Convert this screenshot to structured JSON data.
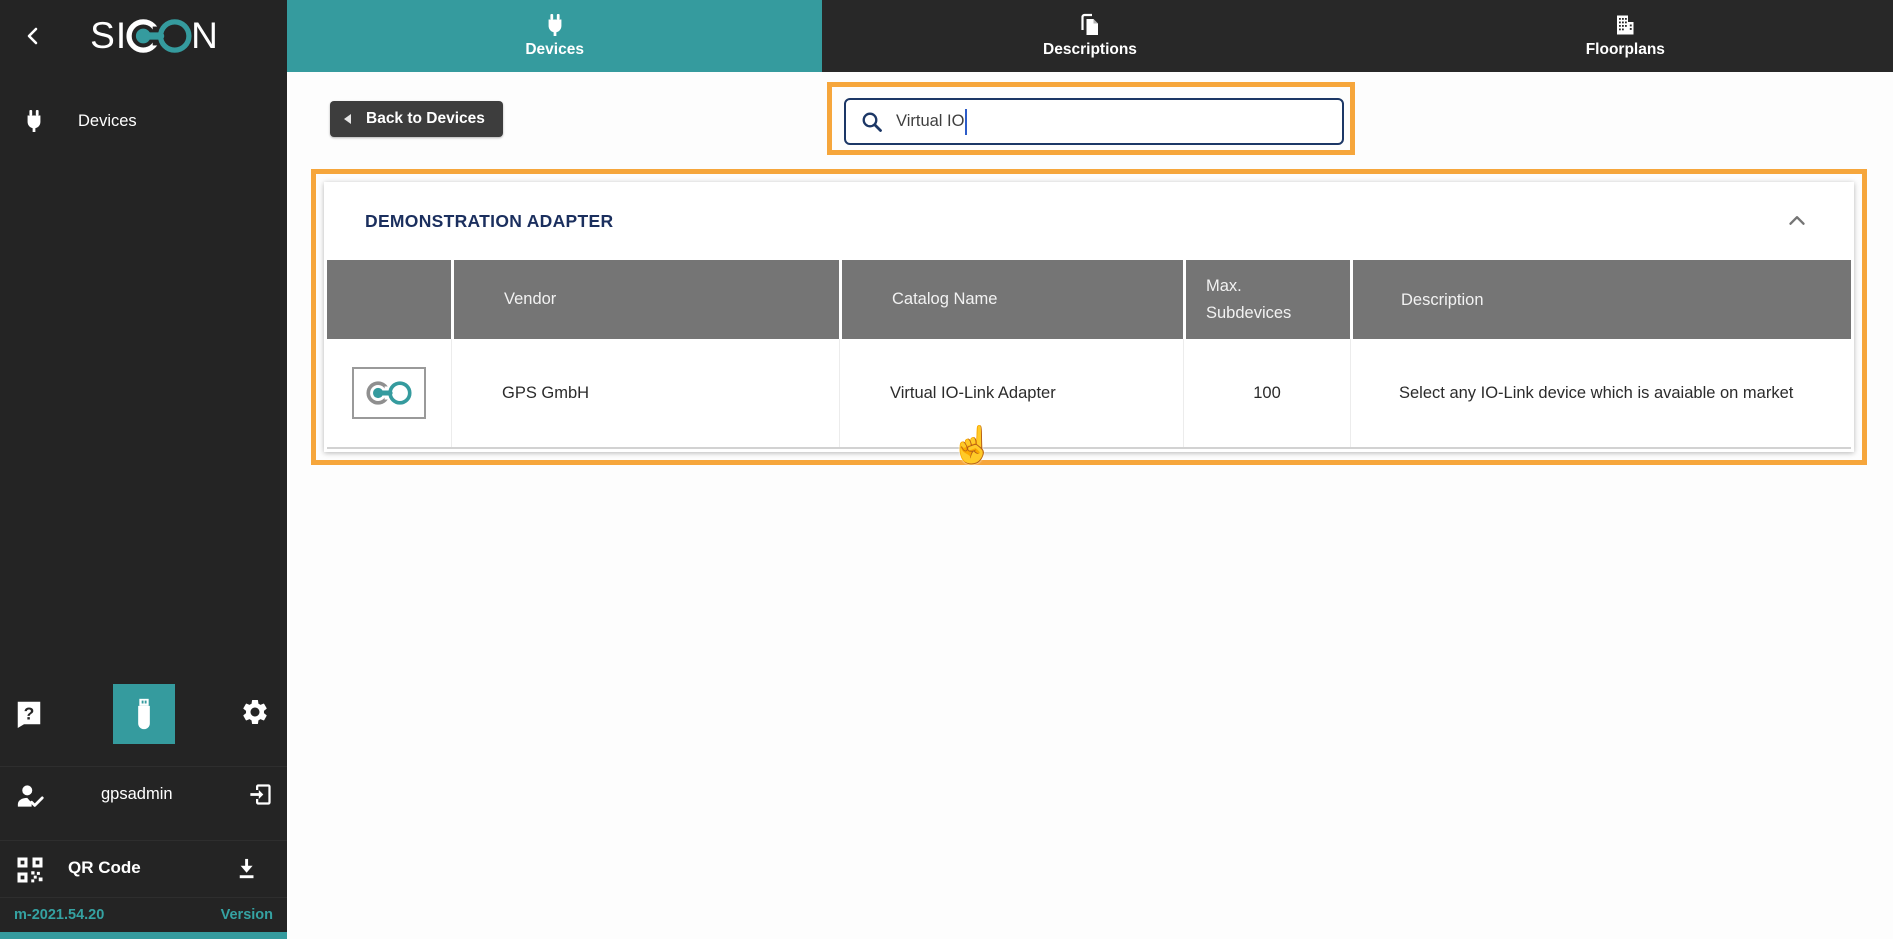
{
  "brand": {
    "logo_left": "SI",
    "logo_right": "N"
  },
  "sidebar": {
    "items": [
      {
        "label": "Devices"
      }
    ],
    "username": "gpsadmin",
    "qr_label": "QR Code",
    "version_value": "m-2021.54.20",
    "version_label": "Version"
  },
  "tabs": [
    {
      "label": "Devices",
      "active": true
    },
    {
      "label": "Descriptions",
      "active": false
    },
    {
      "label": "Floorplans",
      "active": false
    }
  ],
  "content": {
    "back_button": "Back to Devices",
    "search_value": "Virtual IO",
    "panel_title": "DEMONSTRATION ADAPTER",
    "table": {
      "headers": {
        "vendor": "Vendor",
        "catalog": "Catalog Name",
        "max_sub": "Max. Subdevices",
        "description": "Description"
      },
      "rows": [
        {
          "vendor": "GPS GmbH",
          "catalog": "Virtual IO-Link Adapter",
          "max_sub": "100",
          "description": "Select any IO-Link device which is avaiable on market"
        }
      ]
    }
  },
  "colors": {
    "accent_teal": "#359b9e",
    "highlight_orange": "#f6a63c",
    "navy": "#1c3766",
    "table_header_gray": "#757575",
    "sidebar_dark": "#242424"
  }
}
